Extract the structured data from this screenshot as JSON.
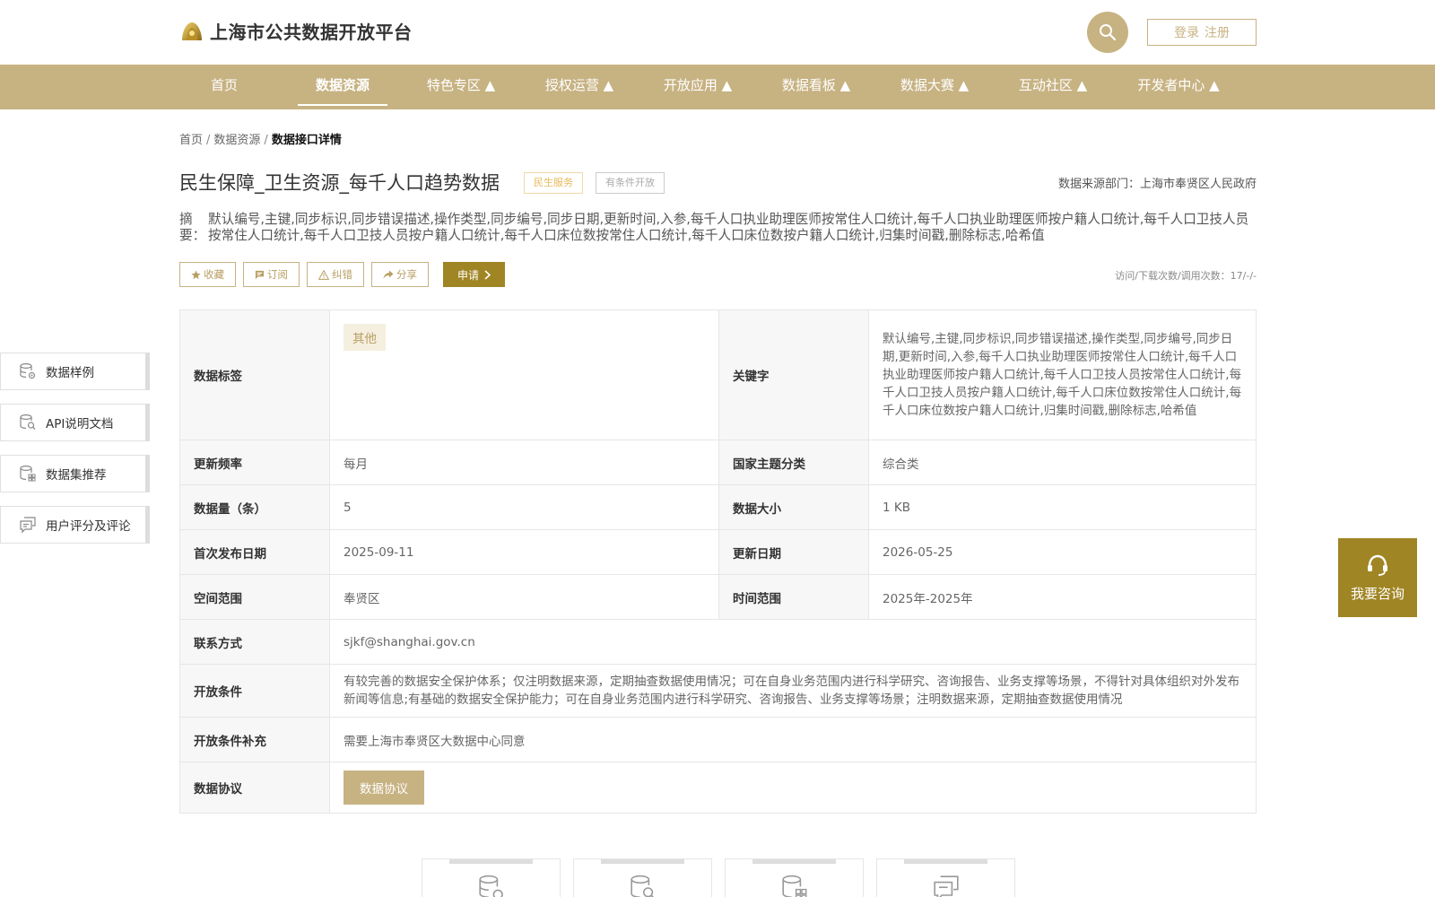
{
  "header": {
    "site_title": "上海市公共数据开放平台",
    "login_label": "登录",
    "register_label": "注册"
  },
  "nav": {
    "items": [
      {
        "label": "首页"
      },
      {
        "label": "数据资源"
      },
      {
        "label": "特色专区 ▲"
      },
      {
        "label": "授权运营 ▲"
      },
      {
        "label": "开放应用 ▲"
      },
      {
        "label": "数据看板 ▲"
      },
      {
        "label": "数据大赛 ▲"
      },
      {
        "label": "互动社区 ▲"
      },
      {
        "label": "开发者中心 ▲"
      }
    ],
    "active_index": 1
  },
  "breadcrumb": {
    "home": "首页",
    "section": "数据资源",
    "current": "数据接口详情",
    "separator": "/"
  },
  "dataset": {
    "title": "民生保障_卫生资源_每千人口趋势数据",
    "tag_category": "民生服务",
    "tag_open": "有条件开放",
    "source_dept": "数据来源部门：上海市奉贤区人民政府",
    "summary_label": "摘要：",
    "summary_text": "默认编号,主键,同步标识,同步错误描述,操作类型,同步编号,同步日期,更新时间,入参,每千人口执业助理医师按常住人口统计,每千人口执业助理医师按户籍人口统计,每千人口卫技人员按常住人口统计,每千人口卫技人员按户籍人口统计,每千人口床位数按常住人口统计,每千人口床位数按户籍人口统计,归集时间戳,删除标志,哈希值"
  },
  "actions": {
    "favorite": "收藏",
    "subscribe": "订阅",
    "report_error": "纠错",
    "share": "分享",
    "apply": "申请",
    "visit_count": "访问/下载次数/调用次数：17/-/-"
  },
  "details": {
    "tags_label": "数据标签",
    "tags_value": "其他",
    "keywords_label": "关键字",
    "keywords_value": "默认编号,主键,同步标识,同步错误描述,操作类型,同步编号,同步日期,更新时间,入参,每千人口执业助理医师按常住人口统计,每千人口执业助理医师按户籍人口统计,每千人口卫技人员按常住人口统计,每千人口卫技人员按户籍人口统计,每千人口床位数按常住人口统计,每千人口床位数按户籍人口统计,归集时间戳,删除标志,哈希值",
    "freq_label": "更新频率",
    "freq_value": "每月",
    "theme_label": "国家主题分类",
    "theme_value": "综合类",
    "count_label": "数据量（条）",
    "count_value": "5",
    "size_label": "数据大小",
    "size_value": "1 KB",
    "first_pub_label": "首次发布日期",
    "first_pub_value": "2025-09-11",
    "update_label": "更新日期",
    "update_value": "2026-05-25",
    "space_label": "空间范围",
    "space_value": "奉贤区",
    "time_label": "时间范围",
    "time_value": "2025年-2025年",
    "contact_label": "联系方式",
    "contact_value": "sjkf@shanghai.gov.cn",
    "cond_label": "开放条件",
    "cond_value": "有较完善的数据安全保护体系；仅注明数据来源，定期抽查数据使用情况；可在自身业务范围内进行科学研究、咨询报告、业务支撑等场景，不得针对具体组织对外发布新闻等信息;有基础的数据安全保护能力；可在自身业务范围内进行科学研究、咨询报告、业务支撑等场景；注明数据来源，定期抽查数据使用情况",
    "cond_extra_label": "开放条件补充",
    "cond_extra_value": "需要上海市奉贤区大数据中心同意",
    "protocol_label": "数据协议",
    "protocol_button": "数据协议"
  },
  "sidemenu": {
    "items": [
      {
        "label": "数据样例",
        "icon": "database-gear-icon"
      },
      {
        "label": "API说明文档",
        "icon": "document-search-icon"
      },
      {
        "label": "数据集推荐",
        "icon": "database-grid-icon"
      },
      {
        "label": "用户评分及评论",
        "icon": "comment-icon"
      }
    ]
  },
  "consult": {
    "label": "我要咨询",
    "icon": "headset-icon"
  },
  "colors": {
    "brand": "#c7b282",
    "brand_dark": "#a08524",
    "tag_orange": "#e9b95a"
  }
}
